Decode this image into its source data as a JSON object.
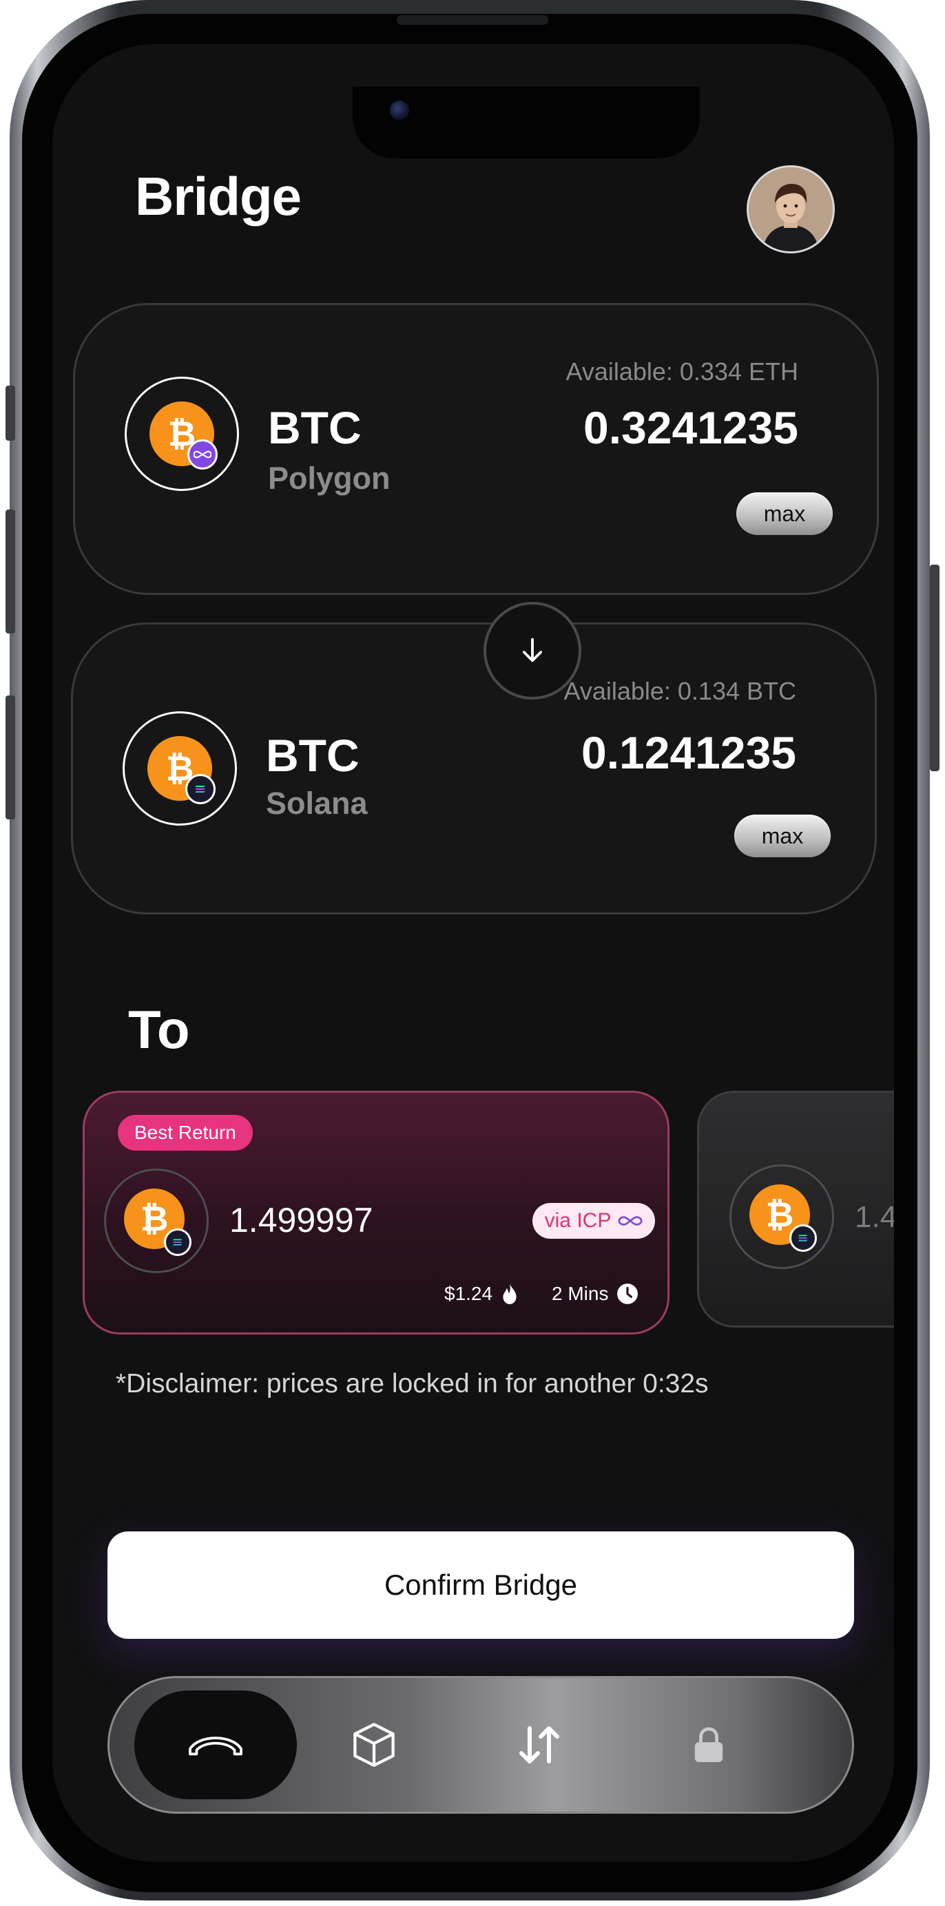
{
  "header": {
    "title": "Bridge"
  },
  "from_cards": [
    {
      "token": "BTC",
      "chain": "Polygon",
      "available": "Available: 0.334 ETH",
      "amount": "0.3241235",
      "max_label": "max",
      "chain_icon": "polygon-icon",
      "chain_color": "#8247e5"
    },
    {
      "token": "BTC",
      "chain": "Solana",
      "available": "Available: 0.134 BTC",
      "amount": "0.1241235",
      "max_label": "max",
      "chain_icon": "solana-icon",
      "chain_color": "#1a1a2e"
    }
  ],
  "swap": {
    "icon": "arrow-down-icon"
  },
  "to": {
    "label": "To",
    "routes": [
      {
        "badge": "Best Return",
        "amount": "1.499997",
        "via": "via ICP",
        "fee": "$1.24",
        "time": "2 Mins"
      },
      {
        "amount": "1.4"
      }
    ]
  },
  "disclaimer": "*Disclaimer: prices are locked in for another 0:32s",
  "confirm_label": "Confirm Bridge",
  "nav": {
    "items": [
      "bridge-icon",
      "cube-icon",
      "swap-arrows-icon",
      "lock-icon"
    ],
    "active": 0
  },
  "colors": {
    "bitcoin": "#f7931a",
    "accent_pink": "#e8337f",
    "background": "#111112"
  }
}
